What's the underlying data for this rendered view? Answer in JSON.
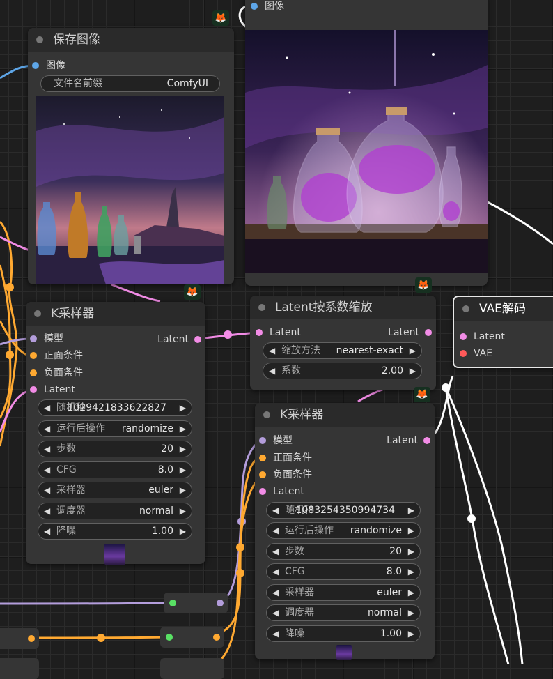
{
  "save_node": {
    "title": "保存图像",
    "input_image": "图像",
    "prefix_label": "文件名前缀",
    "prefix_value": "ComfyUI"
  },
  "preview_node": {
    "input_image": "图像"
  },
  "ksampler1": {
    "title": "K采样器",
    "inputs": [
      "模型",
      "正面条件",
      "负面条件",
      "Latent"
    ],
    "output": "Latent",
    "widgets": [
      {
        "label": "随机种",
        "value": "1029421833622827"
      },
      {
        "label": "运行后操作",
        "value": "randomize"
      },
      {
        "label": "步数",
        "value": "20"
      },
      {
        "label": "CFG",
        "value": "8.0"
      },
      {
        "label": "采样器",
        "value": "euler"
      },
      {
        "label": "调度器",
        "value": "normal"
      },
      {
        "label": "降噪",
        "value": "1.00"
      }
    ]
  },
  "latent_scale": {
    "title": "Latent按系数缩放",
    "input": "Latent",
    "output": "Latent",
    "widgets": [
      {
        "label": "缩放方法",
        "value": "nearest-exact"
      },
      {
        "label": "系数",
        "value": "2.00"
      }
    ]
  },
  "ksampler2": {
    "title": "K采样器",
    "inputs": [
      "模型",
      "正面条件",
      "负面条件",
      "Latent"
    ],
    "output": "Latent",
    "widgets": [
      {
        "label": "随机种",
        "value": "1083254350994734"
      },
      {
        "label": "运行后操作",
        "value": "randomize"
      },
      {
        "label": "步数",
        "value": "20"
      },
      {
        "label": "CFG",
        "value": "8.0"
      },
      {
        "label": "采样器",
        "value": "euler"
      },
      {
        "label": "调度器",
        "value": "normal"
      },
      {
        "label": "降噪",
        "value": "1.00"
      }
    ]
  },
  "vae_decode": {
    "title": "VAE解码",
    "inputs": [
      "Latent",
      "VAE"
    ]
  },
  "badge_icon": "fox-icon",
  "badge_glyph": "🦊",
  "colors": {
    "model_wire": "#b39ddb",
    "cond_wire": "#ffa931",
    "latent_wire": "#f28ce6",
    "image_wire": "#5ea6e8",
    "vae_wire": "#ff5a5a"
  }
}
